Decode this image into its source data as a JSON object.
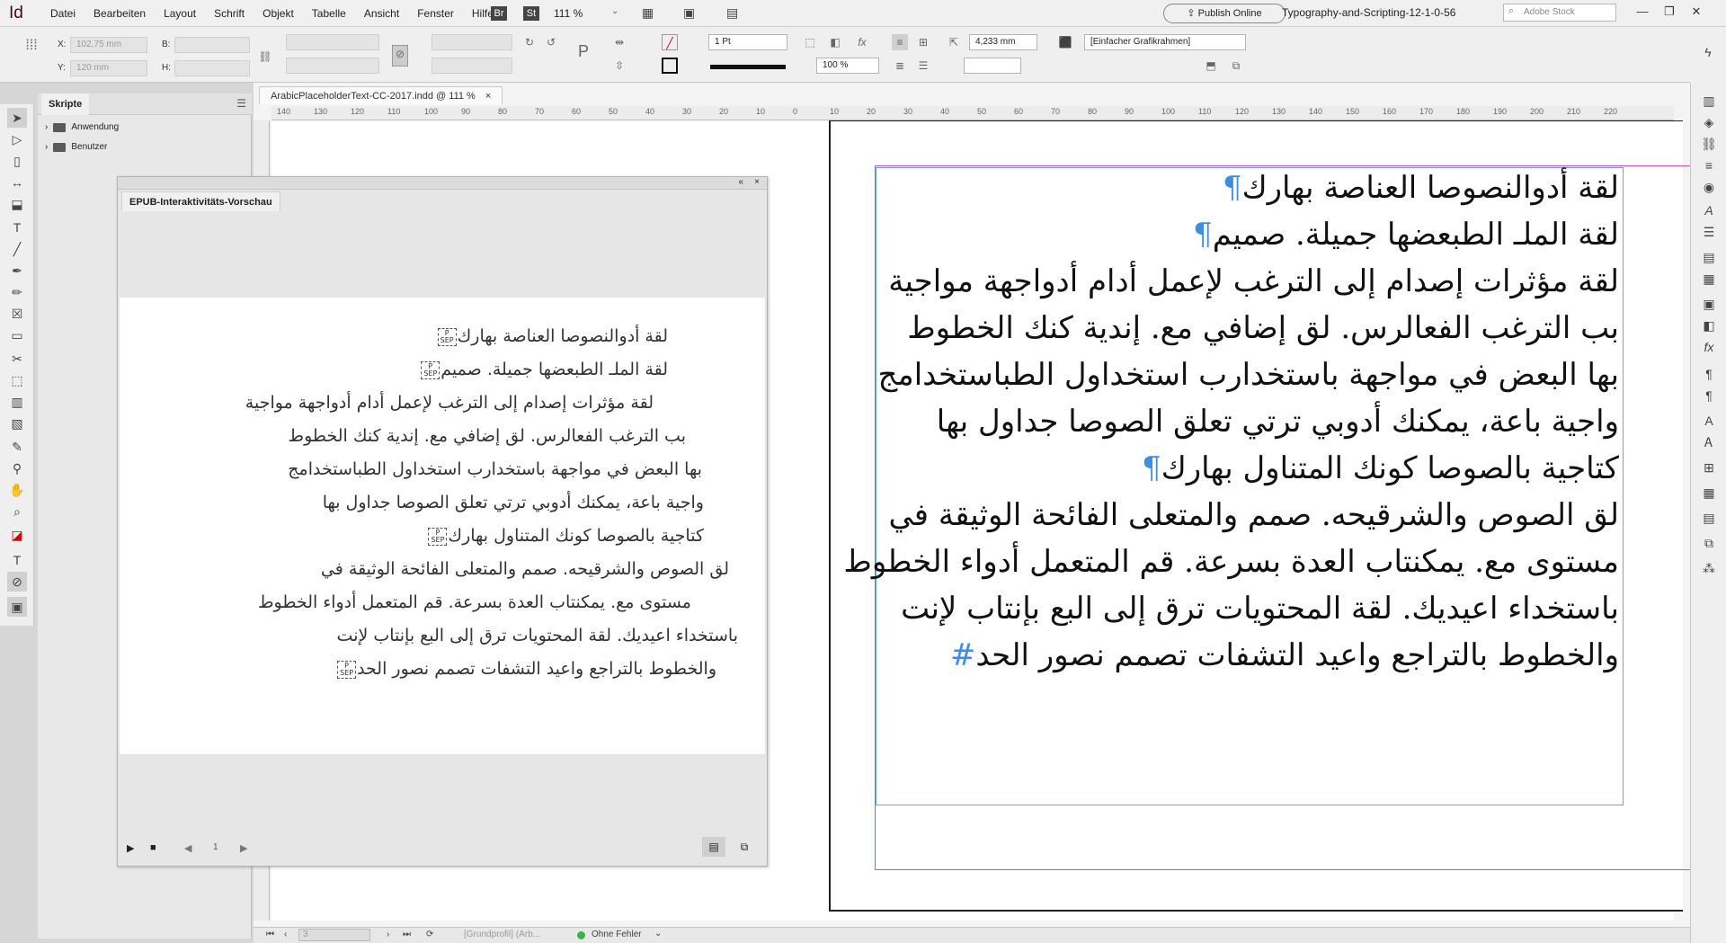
{
  "app": {
    "logo": "Id",
    "menus": [
      "Datei",
      "Bearbeiten",
      "Layout",
      "Schrift",
      "Objekt",
      "Tabelle",
      "Ansicht",
      "Fenster",
      "Hilfe"
    ],
    "bridge_badge": "Br",
    "stock_badge": "St",
    "zoom": "111 %",
    "publish_online": "Publish Online",
    "workspace": "Typography-and-Scripting-12-1-0-56",
    "search_placeholder": "Adobe Stock"
  },
  "control": {
    "x_label": "X:",
    "y_label": "Y:",
    "x_value": "102,75 mm",
    "y_value": "120 mm",
    "b_label": "B:",
    "h_label": "H:",
    "stroke_weight": "1 Pt",
    "opacity": "100 %",
    "gap": "4,233 mm",
    "object_style": "[Einfacher Grafikrahmen]"
  },
  "scripts_panel": {
    "title": "Skripte",
    "items": [
      "Anwendung",
      "Benutzer"
    ]
  },
  "document": {
    "tab_title": "ArabicPlaceholderText-CC-2017.indd @ 111 %",
    "ruler_ticks": [
      "140",
      "130",
      "120",
      "110",
      "100",
      "90",
      "80",
      "70",
      "60",
      "50",
      "40",
      "30",
      "20",
      "10",
      "0",
      "10",
      "20",
      "30",
      "40",
      "50",
      "60",
      "70",
      "80",
      "90",
      "100",
      "110",
      "120",
      "130",
      "140",
      "150",
      "160",
      "170",
      "180",
      "190",
      "200",
      "210",
      "220"
    ],
    "lines": [
      "لقة أدوالنصوصا العناصة بهارك",
      "لقة الملـ الطبعضها جميلة. صميم",
      "لقة مؤثرات إصدام إلى الترغب لإعمل أدام أدواجهة مواجية",
      "بب الترغب الفعالرس. لق إضافي مع. إندية كنك الخطوط",
      "بها البعض في مواجهة باستخدارب استخداول الطباستخدامج",
      "واجية باعة، يمكنك أدوبي ترتي تعلق الصوصا جداول بها",
      "كتاجية بالصوصا كونك المتناول بهارك",
      "لق الصوص والشرقيحه. صمم والمتعلى الفائحة الوثيقة في",
      "مستوى مع. يمكنتاب العدة بسرعة. قم المتعمل أدواء الخطوط",
      "باستخداء اعيديك. لقة المحتويات ترق إلى البع بإنتاب لإنت",
      "والخطوط بالتراجع واعيد التشفات تصمم نصور الحد"
    ],
    "para_mark": "¶",
    "end_mark": "#"
  },
  "epub_panel": {
    "title": "EPUB-Interaktivitäts-Vorschau",
    "sep_top": "P",
    "sep_bottom": "SEP",
    "page_number": "1",
    "lines": [
      "لقة أدوالنصوصا العناصة بهارك",
      "لقة الملـ الطبعضها جميلة. صميم",
      "لقة مؤثرات إصدام إلى الترغب لإعمل أدام أدواجهة مواجية",
      "بب الترغب الفعالرس. لق إضافي مع. إندية كنك الخطوط",
      "بها البعض في مواجهة باستخدارب استخداول الطباستخدامج",
      "واجية باعة، يمكنك أدوبي ترتي تعلق الصوصا جداول بها",
      "كتاجية بالصوصا كونك المتناول بهارك",
      "لق الصوص والشرقيحه. صمم والمتعلى الفائحة الوثيقة في",
      "مستوى مع. يمكنتاب العدة بسرعة. قم المتعمل أدواء الخطوط",
      "باستخداء اعيديك. لقة المحتويات ترق إلى البع بإنتاب لإنت",
      "والخطوط بالتراجع واعيد التشفات تصمم نصور الحد"
    ]
  },
  "status": {
    "page": "3",
    "profile": "[Grundprofil] (Arb...",
    "errors": "Ohne Fehler",
    "ok_color": "#3cb34a"
  }
}
